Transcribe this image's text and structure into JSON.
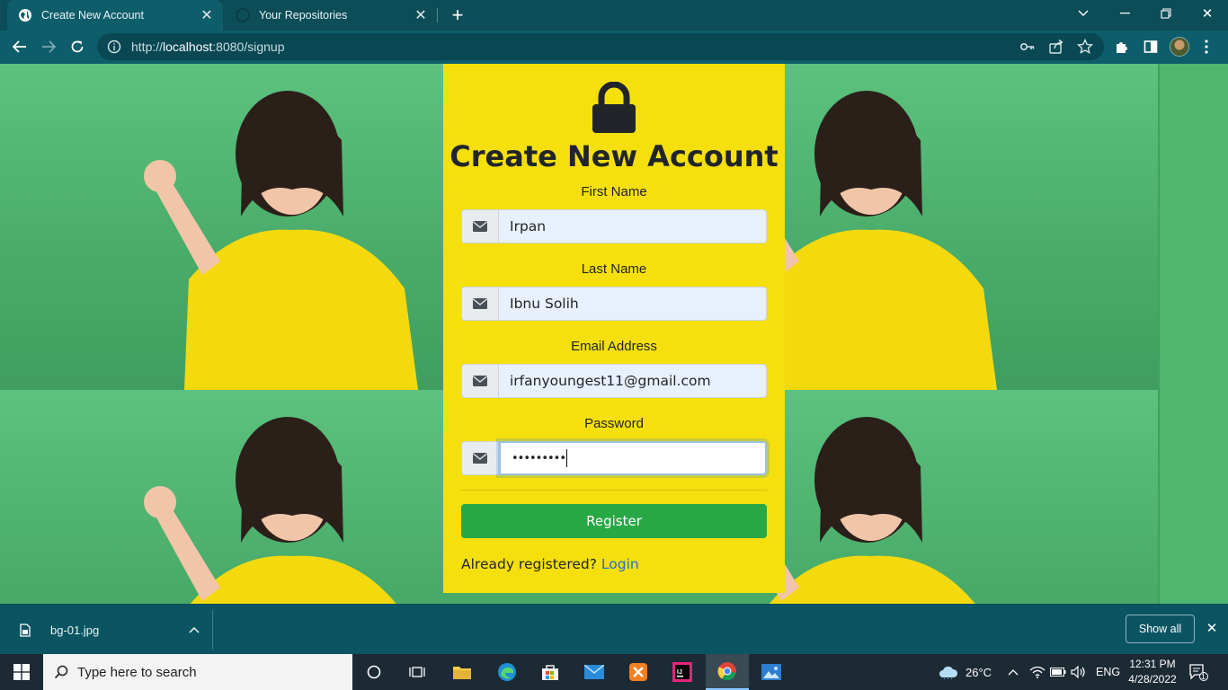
{
  "browser": {
    "tabs": [
      {
        "title": "Create New Account",
        "active": true
      },
      {
        "title": "Your Repositories",
        "active": false
      }
    ],
    "url_prefix": "http://",
    "url_host": "localhost",
    "url_path": ":8080/signup"
  },
  "form": {
    "heading": "Create New Account",
    "first_name_label": "First Name",
    "first_name_value": "Irpan",
    "last_name_label": "Last Name",
    "last_name_value": "Ibnu Solih",
    "email_label": "Email Address",
    "email_value": "irfanyoungest11@gmail.com",
    "password_label": "Password",
    "password_masked": "•••••••••",
    "register_label": "Register",
    "already_text": "Already registered?",
    "login_link": "Login"
  },
  "downloads": {
    "file_name": "bg-01.jpg",
    "show_all_label": "Show all"
  },
  "taskbar": {
    "search_placeholder": "Type here to search",
    "weather": "26°C",
    "language": "ENG",
    "time": "12:31 PM",
    "date": "4/28/2022",
    "notification_count": "1"
  },
  "colors": {
    "card": "#f5df0d",
    "register_button": "#28a745",
    "link": "#1a73c9",
    "chrome_frame": "#0e5d6b"
  }
}
